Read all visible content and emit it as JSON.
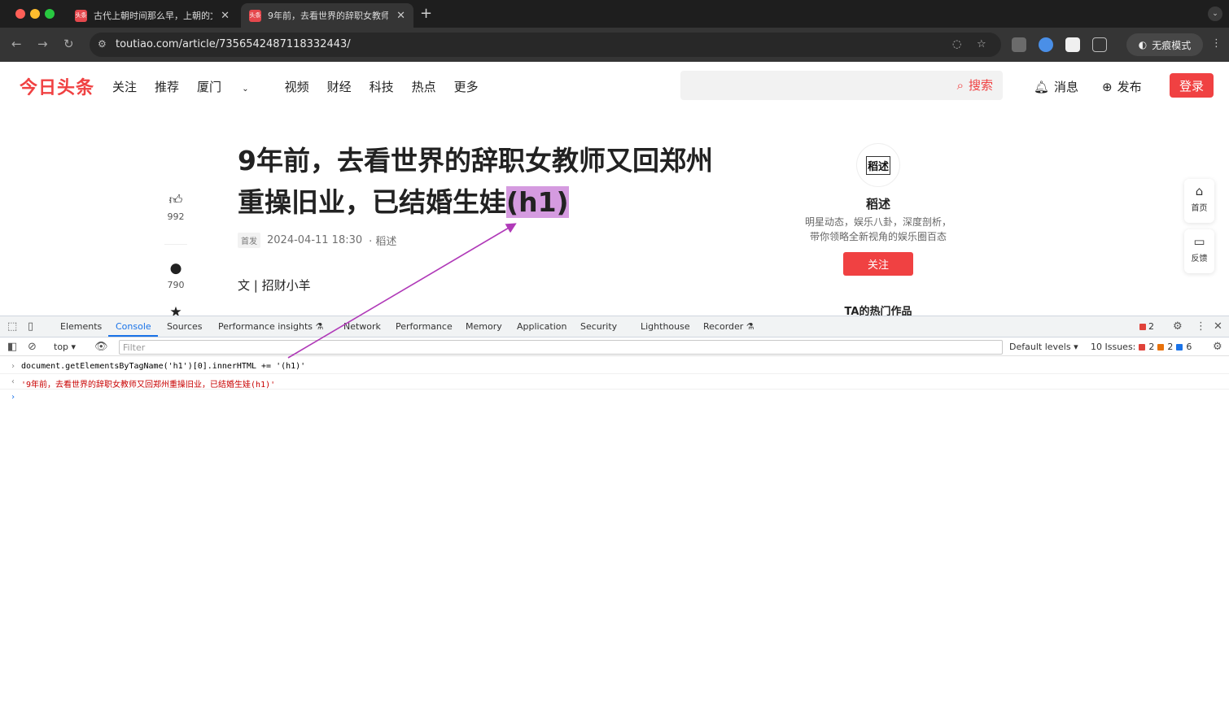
{
  "browser": {
    "tabs": [
      {
        "favicon": "头条",
        "title": "古代上朝时间那么早，上朝的文"
      },
      {
        "favicon": "头条",
        "title": "9年前，去看世界的辞职女教师"
      }
    ],
    "new_tab": "+",
    "url": "toutiao.com/article/7356542487118332443/",
    "incognito_label": "无痕模式",
    "colors": {
      "accent": "#f04142",
      "devtools_accent": "#1a73e8",
      "h1_highlight": "#d59be0",
      "arrow": "#b03ab8"
    }
  },
  "site": {
    "logo": "今日头条",
    "nav": [
      "关注",
      "推荐",
      "厦门",
      "视频",
      "财经",
      "科技",
      "热点",
      "更多"
    ],
    "search_label": "搜索",
    "messages_label": "消息",
    "publish_label": "发布",
    "login_label": "登录"
  },
  "article": {
    "title_main": "9年前，去看世界的辞职女教师又回郑州重操旧业，已结婚生娃",
    "title_suffix": "(h1)",
    "first_badge": "首发",
    "date": "2024-04-11 18:30",
    "source": "· 稻述",
    "byline": "文 | 招财小羊",
    "like_count": "992",
    "comment_count": "790"
  },
  "author": {
    "avatar_text": "稻述",
    "name": "稻述",
    "desc_line1": "明星动态，娱乐八卦，深度剖析，",
    "desc_line2": "带你领略全新视角的娱乐圈百态",
    "follow_label": "关注",
    "hot_works": "TA的热门作品"
  },
  "float": {
    "home": "首页",
    "feedback": "反馈"
  },
  "devtools": {
    "tabs": [
      "Elements",
      "Console",
      "Sources",
      "Performance insights",
      "Network",
      "Performance",
      "Memory",
      "Application",
      "Security",
      "Lighthouse",
      "Recorder"
    ],
    "active_tab": "Console",
    "error_count": "2",
    "context": "top",
    "filter_placeholder": "Filter",
    "levels": "Default levels",
    "issues_label": "10 Issues:",
    "issues_errors": "2",
    "issues_warnings": "2",
    "issues_info": "6",
    "console": {
      "input_code": "document.getElementsByTagName('h1')[0].innerHTML += '(h1)'",
      "result": "'9年前，去看世界的辞职女教师又回郑州重操旧业，已结婚生娃(h1)'"
    }
  }
}
